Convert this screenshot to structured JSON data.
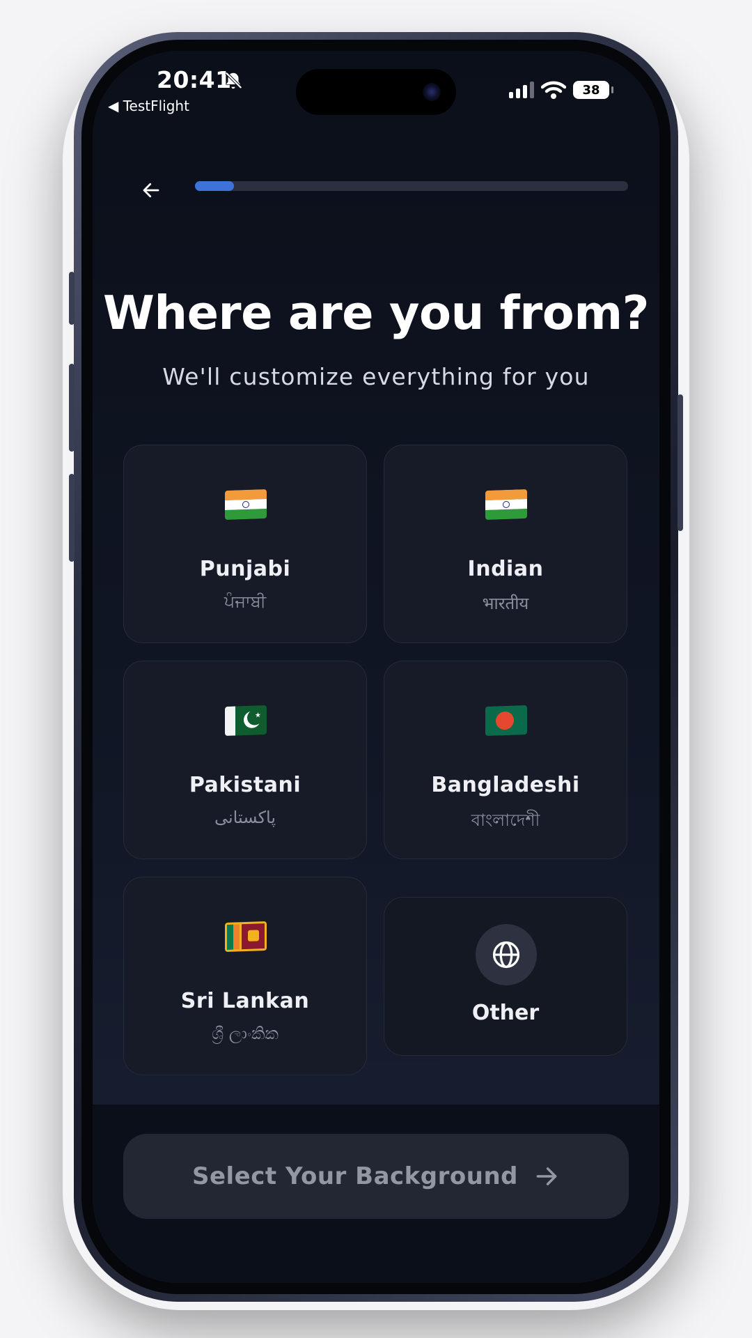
{
  "status_bar": {
    "time": "20:41",
    "back_app": "◀ TestFlight",
    "battery": "38"
  },
  "header": {
    "progress": 0.09
  },
  "title": "Where are you from?",
  "subtitle": "We'll customize everything for you",
  "options": [
    {
      "name": "Punjabi",
      "native": "ਪੰਜਾਬੀ",
      "flag": "india-flag"
    },
    {
      "name": "Indian",
      "native": "भारतीय",
      "flag": "india-flag"
    },
    {
      "name": "Pakistani",
      "native": "پاکستانی",
      "flag": "pakistan-flag"
    },
    {
      "name": "Bangladeshi",
      "native": "বাংলাদেশী",
      "flag": "bangladesh-flag"
    },
    {
      "name": "Sri Lankan",
      "native": "ශ්‍රී ලාංකික",
      "flag": "sri-lanka-flag"
    },
    {
      "name": "Other",
      "icon": "globe-icon"
    }
  ],
  "cta": {
    "label": "Select Your Background"
  },
  "colors": {
    "accent": "#3d73d8",
    "background": "#0b0f19",
    "card": "#171b27"
  }
}
